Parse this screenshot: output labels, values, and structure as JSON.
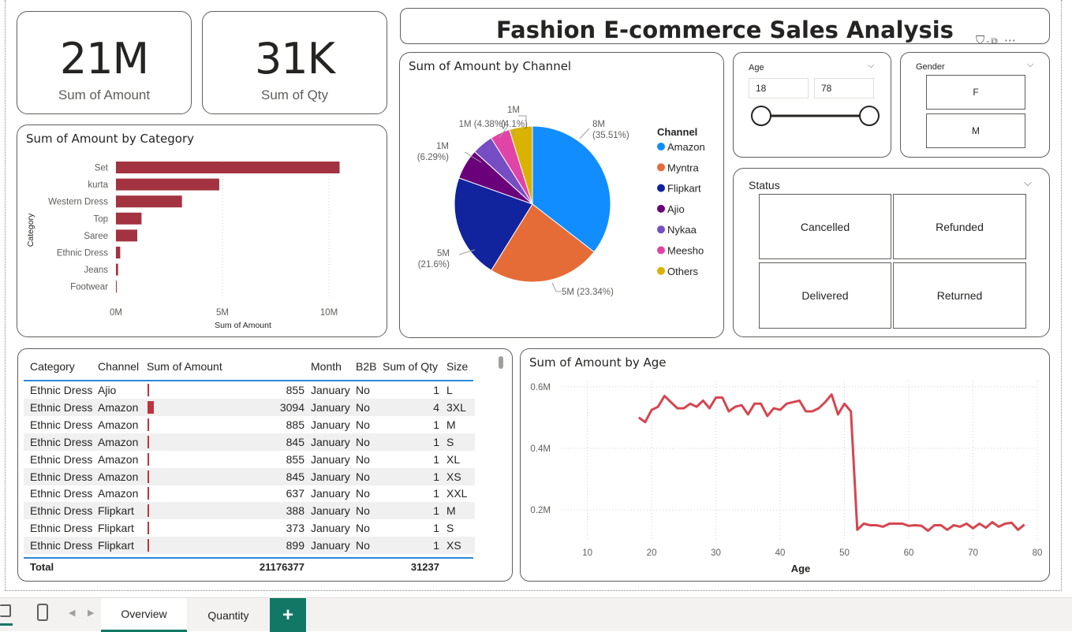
{
  "kpis": [
    {
      "value": "21M",
      "label": "Sum of Amount"
    },
    {
      "value": "31K",
      "label": "Sum of Qty"
    }
  ],
  "header": {
    "title": "Fashion E-commerce Sales Analysis"
  },
  "category_chart": {
    "title": "Sum of Amount by Category",
    "xlabel": "Sum of Amount",
    "ylabel": "Category",
    "xticks": [
      "0M",
      "5M",
      "10M"
    ],
    "bar_color": "#a33340"
  },
  "channel_chart": {
    "title": "Sum of Amount by Channel",
    "legend_title": "Channel"
  },
  "age_chart": {
    "title": "Sum of Amount by Age",
    "xlabel": "Age",
    "line_color": "#d64550"
  },
  "age_slicer": {
    "label": "Age",
    "min": "18",
    "max": "78"
  },
  "gender_slicer": {
    "label": "Gender",
    "options": [
      "F",
      "M"
    ]
  },
  "status_slicer": {
    "label": "Status",
    "options": [
      "Cancelled",
      "Refunded",
      "Delivered",
      "Returned"
    ]
  },
  "table": {
    "headers": [
      "Category",
      "Channel",
      "Sum of Amount",
      "Month",
      "B2B",
      "Sum of Qty",
      "Size"
    ],
    "rows": [
      [
        "Ethnic Dress",
        "Ajio",
        "855",
        "January",
        "No",
        "1",
        "L"
      ],
      [
        "Ethnic Dress",
        "Amazon",
        "3094",
        "January",
        "No",
        "4",
        "3XL"
      ],
      [
        "Ethnic Dress",
        "Amazon",
        "885",
        "January",
        "No",
        "1",
        "M"
      ],
      [
        "Ethnic Dress",
        "Amazon",
        "845",
        "January",
        "No",
        "1",
        "S"
      ],
      [
        "Ethnic Dress",
        "Amazon",
        "855",
        "January",
        "No",
        "1",
        "XL"
      ],
      [
        "Ethnic Dress",
        "Amazon",
        "845",
        "January",
        "No",
        "1",
        "XS"
      ],
      [
        "Ethnic Dress",
        "Amazon",
        "637",
        "January",
        "No",
        "1",
        "XXL"
      ],
      [
        "Ethnic Dress",
        "Flipkart",
        "388",
        "January",
        "No",
        "1",
        "M"
      ],
      [
        "Ethnic Dress",
        "Flipkart",
        "373",
        "January",
        "No",
        "1",
        "S"
      ],
      [
        "Ethnic Dress",
        "Flipkart",
        "899",
        "January",
        "No",
        "1",
        "XS"
      ]
    ],
    "total_label": "Total",
    "total_amount": "21176377",
    "total_qty": "31237"
  },
  "tabs": {
    "overview": "Overview",
    "quantity": "Quantity",
    "add": "+"
  },
  "colors": {
    "accent": "#117865",
    "bar": "#a33340",
    "line": "#d64550",
    "table_bar": "#c0323f"
  },
  "chart_data": [
    {
      "type": "bar",
      "orientation": "horizontal",
      "title": "Sum of Amount by Category",
      "categories": [
        "Set",
        "kurta",
        "Western Dress",
        "Top",
        "Saree",
        "Ethnic Dress",
        "Jeans",
        "Footwear"
      ],
      "values": [
        10.5,
        4.85,
        3.1,
        1.2,
        1.0,
        0.2,
        0.1,
        0.02
      ],
      "unit": "M",
      "xlabel": "Sum of Amount",
      "ylabel": "Category",
      "xlim": [
        0,
        12
      ]
    },
    {
      "type": "pie",
      "title": "Sum of Amount by Channel",
      "slices": [
        {
          "name": "Amazon",
          "value": 35.51,
          "label": "8M\n(35.51%)",
          "color": "#118dff"
        },
        {
          "name": "Myntra",
          "value": 23.34,
          "label": "5M (23.34%)",
          "color": "#e66c37"
        },
        {
          "name": "Flipkart",
          "value": 21.6,
          "label": "5M\n(21.6%)",
          "color": "#12239e"
        },
        {
          "name": "Ajio",
          "value": 6.29,
          "label": "1M\n(6.29%)",
          "color": "#6b007b"
        },
        {
          "name": "Nykaa",
          "value": 4.38,
          "label": "1M (4.38%)",
          "color": "#744ec2"
        },
        {
          "name": "Meesho",
          "value": 4.1,
          "label": "(4.1%)",
          "color": "#e044a7"
        },
        {
          "name": "Others",
          "value": 4.78,
          "label": "1M",
          "color": "#d9b300"
        }
      ]
    },
    {
      "type": "line",
      "title": "Sum of Amount by Age",
      "xlabel": "Age",
      "ylabel": "",
      "xlim": [
        6,
        80
      ],
      "ylim": [
        0.1,
        0.62
      ],
      "xticks": [
        10,
        20,
        30,
        40,
        50,
        60,
        70,
        80
      ],
      "yticks": [
        {
          "v": 0.2,
          "t": "0.2M"
        },
        {
          "v": 0.4,
          "t": "0.4M"
        },
        {
          "v": 0.6,
          "t": "0.6M"
        }
      ],
      "x": [
        18,
        19,
        20,
        21,
        22,
        23,
        24,
        25,
        26,
        27,
        28,
        29,
        30,
        31,
        32,
        33,
        34,
        35,
        36,
        37,
        38,
        39,
        40,
        41,
        42,
        43,
        44,
        45,
        46,
        47,
        48,
        49,
        50,
        51,
        52,
        53,
        54,
        55,
        56,
        57,
        58,
        59,
        60,
        61,
        62,
        63,
        64,
        65,
        66,
        67,
        68,
        69,
        70,
        71,
        72,
        73,
        74,
        75,
        76,
        77,
        78
      ],
      "y": [
        0.5,
        0.485,
        0.525,
        0.535,
        0.57,
        0.55,
        0.53,
        0.53,
        0.545,
        0.535,
        0.555,
        0.53,
        0.565,
        0.565,
        0.52,
        0.535,
        0.54,
        0.51,
        0.545,
        0.545,
        0.505,
        0.53,
        0.525,
        0.545,
        0.55,
        0.555,
        0.52,
        0.52,
        0.53,
        0.55,
        0.575,
        0.51,
        0.545,
        0.52,
        0.135,
        0.155,
        0.15,
        0.15,
        0.145,
        0.155,
        0.155,
        0.155,
        0.148,
        0.15,
        0.148,
        0.132,
        0.15,
        0.15,
        0.135,
        0.15,
        0.145,
        0.155,
        0.14,
        0.155,
        0.142,
        0.16,
        0.145,
        0.155,
        0.158,
        0.135,
        0.152
      ]
    }
  ]
}
